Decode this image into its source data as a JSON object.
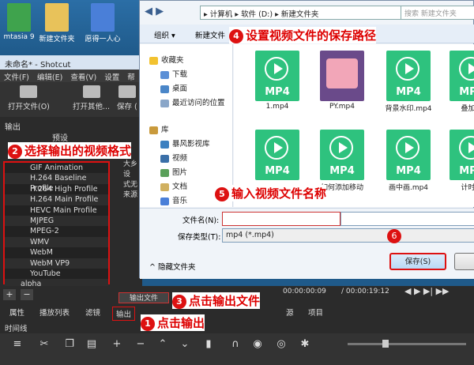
{
  "desktop": {
    "icons": [
      "mtasia 9",
      "新建文件夹",
      "愿得一人心"
    ]
  },
  "shotcut": {
    "title": "未命名* - Shotcut",
    "menu": [
      "文件(F)",
      "编辑(E)",
      "查看(V)",
      "设置",
      "帮"
    ],
    "toolbar": {
      "open": "打开文件(O)",
      "open_other": "打开其他...",
      "save": "保存 ("
    },
    "output_label": "输出",
    "presets_label": "预设",
    "formats": [
      "GIF Animation",
      "H.264 Baseline Profile",
      "H.264 High Profile",
      "H.264 Main Profile",
      "HEVC Main Profile",
      "MJPEG",
      "MPEG-2",
      "WMV",
      "WebM",
      "WebM VP9",
      "YouTube",
      "alpha"
    ],
    "side_text": [
      "大乡",
      "设",
      "式无",
      "来源"
    ],
    "output_file_btn": "输出文件",
    "tabs": [
      "属性",
      "播放列表",
      "滤镜",
      "输出"
    ],
    "time_current": "00:00:00:09",
    "time_total": "/ 00:00:19:12",
    "source_tab": "源",
    "project_tab": "项目",
    "timeline_label": "时间线"
  },
  "dialog": {
    "breadcrumb": [
      "计算机",
      "软件 (D:)",
      "新建文件夹"
    ],
    "search_placeholder": "搜索 新建文件夹",
    "organize": "组织 ▾",
    "new_folder": "新建文件",
    "nav": [
      "收藏夹",
      "下载",
      "桌面",
      "最近访问的位置",
      "库",
      "暴风影视库",
      "视频",
      "图片",
      "文档",
      "音乐"
    ],
    "files": [
      {
        "name": "1.mp4",
        "tag": "MP4"
      },
      {
        "name": "PY.mp4",
        "tag": ""
      },
      {
        "name": "背景水印.mp4",
        "tag": "MP4"
      },
      {
        "name": "叠加视",
        "tag": "MP4"
      },
      {
        "name": "",
        "tag": "MP4"
      },
      {
        "name": "",
        "tag": "MP4"
      },
      {
        "name": "",
        "tag": "MP4"
      },
      {
        "name": "",
        "tag": "MP4"
      }
    ],
    "files_row2_labels": [
      "如何添加移动",
      "画中画.mp4",
      "计时器"
    ],
    "filename_label": "文件名(N):",
    "filename_value": "",
    "filetype_label": "保存类型(T):",
    "filetype_value": "mp4 (*.mp4)",
    "hide_folders": "隐藏文件夹",
    "save": "保存(S)"
  },
  "annotations": {
    "a1": "点击输出",
    "a2": "选择输出的视频格式",
    "a3": "点击输出文件",
    "a4": "设置视频文件的保存路径",
    "a5": "输入视频文件名称",
    "a6": ""
  }
}
